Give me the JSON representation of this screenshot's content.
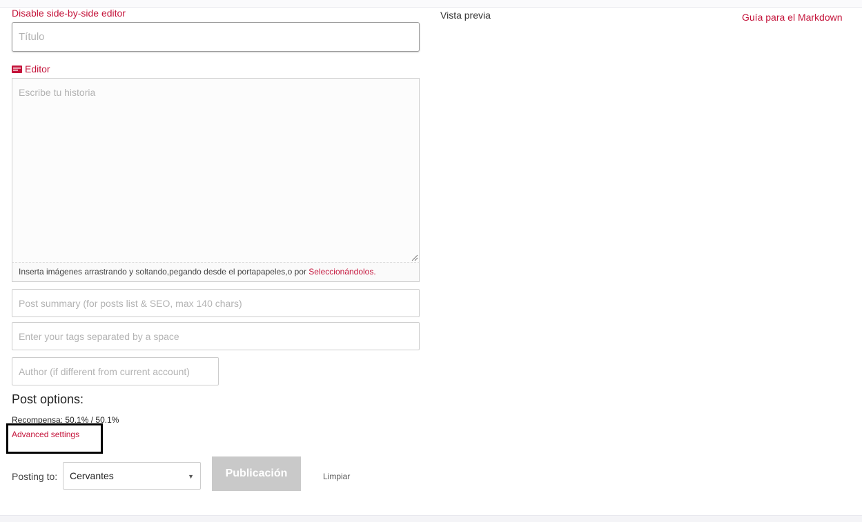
{
  "editor": {
    "disable_side_by_side": "Disable side-by-side editor",
    "title_placeholder": "Título",
    "editor_label": "Editor",
    "body_placeholder": "Escribe tu historia",
    "upload_hint_text": "Inserta imágenes arrastrando y soltando,pegando desde el portapapeles,o por ",
    "upload_hint_link": "Seleccionándolos.",
    "summary_placeholder": "Post summary (for posts list & SEO, max 140 chars)",
    "tags_placeholder": "Enter your tags separated by a space",
    "author_placeholder": "Author (if different from current account)"
  },
  "post_options": {
    "heading": "Post options:",
    "reward": "Recompensa: 50.1% / 50.1%",
    "advanced_settings": "Advanced settings"
  },
  "footer": {
    "posting_to_label": "Posting to:",
    "posting_to_value": "Cervantes",
    "publish_label": "Publicación",
    "clear_label": "Limpiar"
  },
  "preview": {
    "label": "Vista previa",
    "markdown_guide": "Guía para el Markdown"
  },
  "colors": {
    "accent": "#c4133a",
    "publish_disabled": "#c9c9c9"
  },
  "icons": {
    "editor": "editor-icon",
    "dropdown": "chevron-down-icon"
  }
}
